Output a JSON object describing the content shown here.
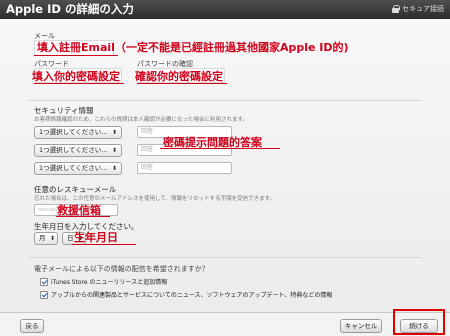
{
  "header": {
    "title": "Apple ID の詳細の入力",
    "secure_label": "セキュア接続"
  },
  "account": {
    "email_label": "メール",
    "email_note": "填入註冊Email（一定不能是已經註冊過其他國家Apple ID的)",
    "password_label": "パスワード",
    "password_note": "填入你的密碼設定",
    "confirm_label": "パスワードの確認",
    "confirm_note": "確認你的密碼設定"
  },
  "security": {
    "heading": "セキュリティ情報",
    "description": "お客様情報確認のため、これらの質問は本人確認が必要になった場合に利用されます。",
    "question_placeholder": "1つ選択してください...",
    "answer_placeholder": "回答",
    "answers_note": "密碼提示問題的答案"
  },
  "rescue": {
    "heading": "任意のレスキューメール",
    "description": "忘れた場合は、この任意のメールアドレスを使用して、情報をリセットする手順を受信できます。",
    "placeholder": "rescue@example.com",
    "note": "救援信箱"
  },
  "birthday": {
    "heading": "生年月日を入力してください。",
    "month_value": "月",
    "day_value": "日",
    "note": "生年月日"
  },
  "preferences": {
    "question": "電子メールによる以下の情報の配信を希望されますか？",
    "option1": "iTunes Store のニューリリースと追加情報",
    "option2": "アップルからの関連製品とサービスについてのニュース、ソフトウェアのアップデート、特典などの情報"
  },
  "footer": {
    "back_label": "戻る",
    "cancel_label": "キャンセル",
    "continue_label": "続ける"
  },
  "colors": {
    "annotation": "#d0021b",
    "highlight": "#e00000"
  }
}
